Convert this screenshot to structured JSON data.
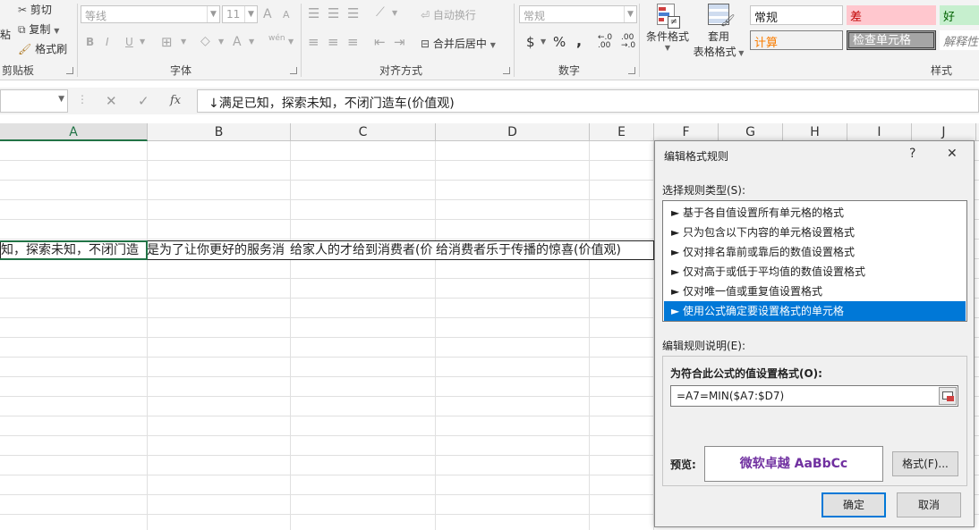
{
  "ribbon": {
    "clipboard": {
      "cut": "剪切",
      "copy": "复制",
      "format_painter": "格式刷",
      "paste_fragment": "粘",
      "label": "剪贴板"
    },
    "font": {
      "name": "等线",
      "size": "11",
      "grow": "A",
      "shrink": "A",
      "bold": "B",
      "italic": "I",
      "underline": "U",
      "font_color": "A",
      "phonetic": "wén",
      "label": "字体"
    },
    "alignment": {
      "wrap_text": "自动换行",
      "merge_center": "合并后居中",
      "label": "对齐方式"
    },
    "number": {
      "format": "常规",
      "currency": "$",
      "percent": "%",
      "comma": ",",
      "increase_decimal": "←.0\n.00",
      "decrease_decimal": ".00\n→.0",
      "label": "数字"
    },
    "styles": {
      "conditional_formatting": "条件格式",
      "format_as_table_1": "套用",
      "format_as_table_2": "表格格式",
      "cells": [
        {
          "text": "常规",
          "fg": "#222222",
          "bg": "#ffffff"
        },
        {
          "text": "差",
          "fg": "#c00000",
          "bg": "#ffc7ce"
        },
        {
          "text": "好",
          "fg": "#006100",
          "bg": "#c6efce"
        },
        {
          "text": "计算",
          "fg": "#fa7d00",
          "bg": "#f2f2f2"
        },
        {
          "text": "检查单元格",
          "fg": "#ffffff",
          "bg": "#a5a5a5"
        },
        {
          "text": "解释性",
          "fg": "#7f7f7f",
          "bg": "#ffffff"
        }
      ],
      "label": "样式"
    }
  },
  "formula_bar": {
    "cancel": "✕",
    "enter": "✓",
    "fx": "fx",
    "content": "↓满足已知，探索未知，不闭门造车(价值观)"
  },
  "sheet": {
    "columns": [
      "A",
      "B",
      "C",
      "D",
      "E",
      "F",
      "G",
      "H",
      "I",
      "J"
    ],
    "selected_column": "A",
    "row7": {
      "a": "知，探索未知，不闭门造",
      "b": "是为了让你更好的服务消",
      "c": "给家人的才给到消费者(价",
      "d": "给消费者乐于传播的惊喜(价值观)"
    }
  },
  "dialog": {
    "title": "编辑格式规则",
    "help": "?",
    "close": "✕",
    "select_rule_type": "选择规则类型(S):",
    "rules": [
      "► 基于各自值设置所有单元格的格式",
      "► 只为包含以下内容的单元格设置格式",
      "► 仅对排名靠前或靠后的数值设置格式",
      "► 仅对高于或低于平均值的数值设置格式",
      "► 仅对唯一值或重复值设置格式",
      "► 使用公式确定要设置格式的单元格"
    ],
    "selected_rule_index": 5,
    "edit_description": "编辑规则说明(E):",
    "formula_label": "为符合此公式的值设置格式(O):",
    "formula_value": "=A7=MIN($A7:$D7)",
    "preview_label": "预览:",
    "preview_text": "微软卓越  AaBbCc",
    "format_button": "格式(F)...",
    "ok": "确定",
    "cancel": "取消",
    "preview_color": "#7030a0",
    "accent": "#0078d7"
  }
}
